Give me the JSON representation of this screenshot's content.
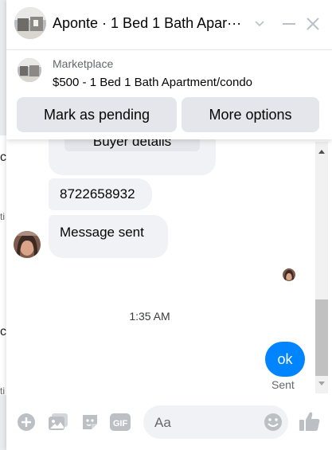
{
  "header": {
    "title": "Aponte · 1 Bed 1 Bath Apar···"
  },
  "listing": {
    "source_label": "Marketplace",
    "title": "$500 - 1 Bed 1 Bath Apartment/condo",
    "buttons": {
      "mark_pending": "Mark as pending",
      "more_options": "More options"
    }
  },
  "messages": {
    "buyer_details_label": "Buyer details",
    "phone_message": "8722658932",
    "status_message": "Message sent",
    "timestamp": "1:35 AM",
    "own_message": "ok",
    "delivery_status": "Sent"
  },
  "composer": {
    "placeholder": "Aa",
    "gif_label": "GIF"
  },
  "background_page": {
    "edge_letters": [
      "c",
      "ti",
      "c",
      "ti"
    ]
  },
  "colors": {
    "accent": "#0084ff",
    "bubble_gray": "#f0f2f5",
    "icon_gray": "#bcc0c4"
  },
  "icons": {
    "header_avatar": "listing-photo-avatar",
    "minimize": "minimize-icon",
    "close": "close-icon",
    "chevron": "chevron-down-icon",
    "actions": [
      "plus-circle-icon",
      "photo-icon",
      "sticker-icon",
      "gif-icon",
      "emoji-icon",
      "thumbs-up-icon"
    ]
  }
}
